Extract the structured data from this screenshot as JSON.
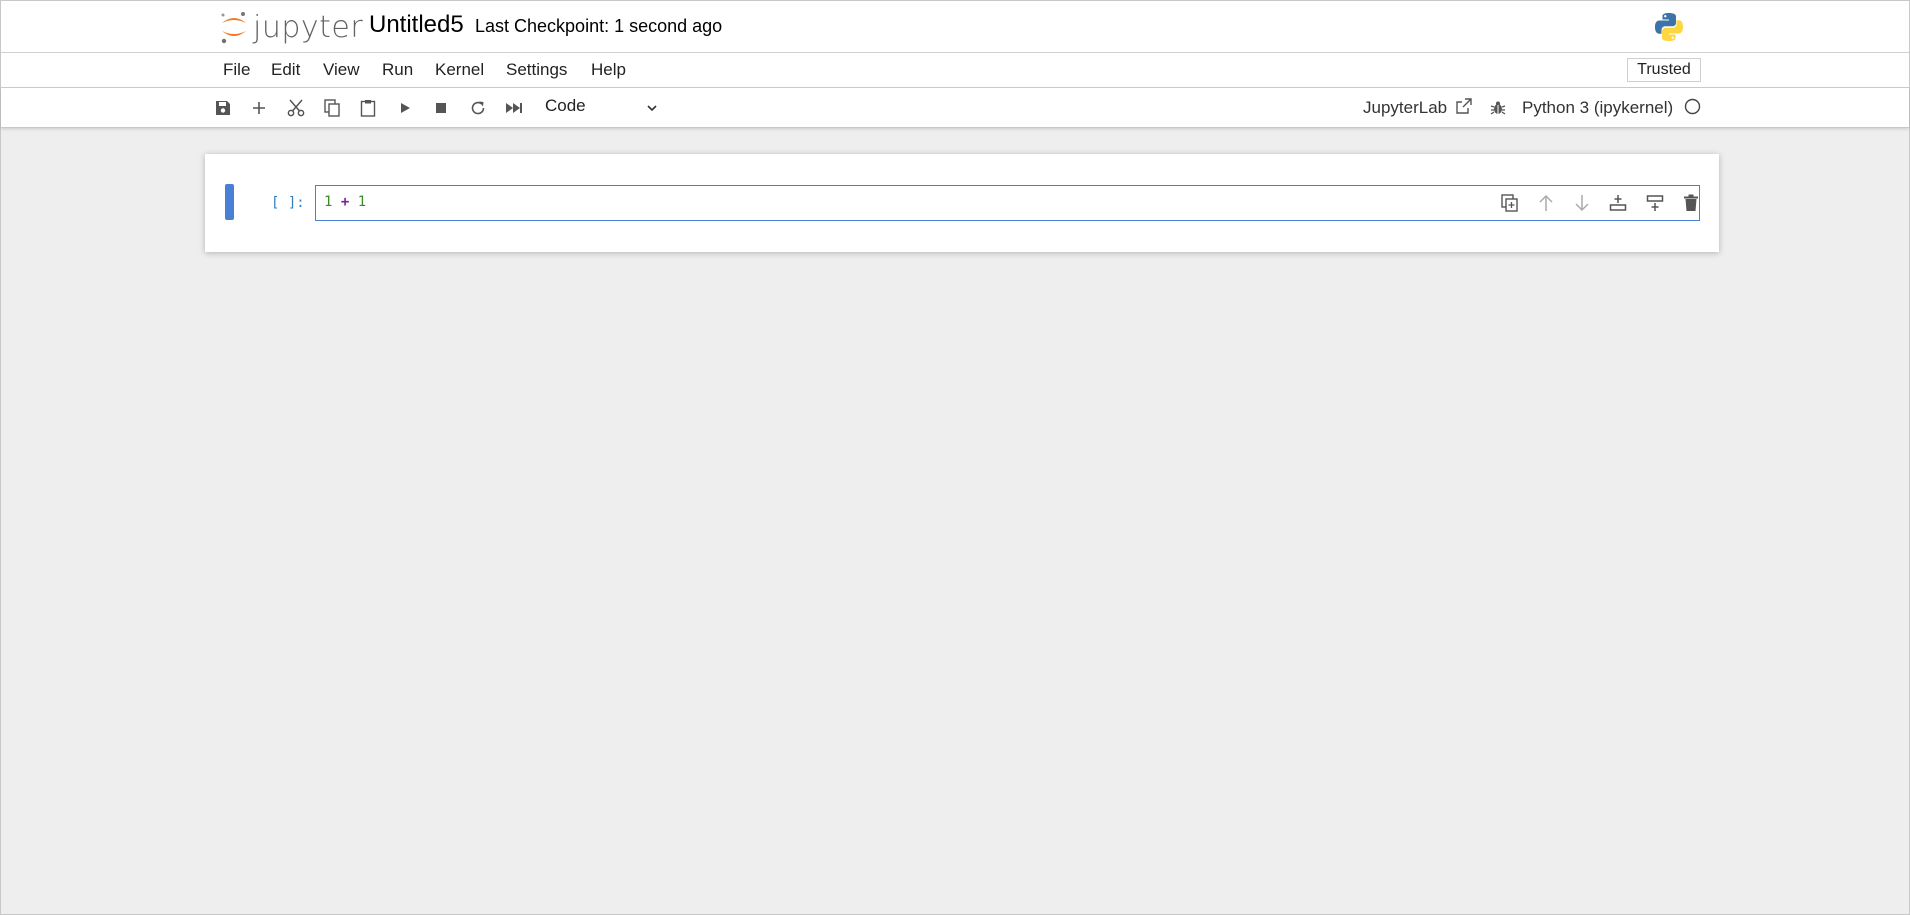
{
  "header": {
    "logo_text": "jupyter",
    "notebook_title": "Untitled5",
    "checkpoint": "Last Checkpoint: 1 second ago",
    "kernel_logo_icon": "python-logo-icon"
  },
  "menu": {
    "items": [
      "File",
      "Edit",
      "View",
      "Run",
      "Kernel",
      "Settings",
      "Help"
    ],
    "trusted_label": "Trusted"
  },
  "toolbar": {
    "buttons": [
      "save-icon",
      "add-cell-icon",
      "cut-icon",
      "copy-icon",
      "paste-icon",
      "run-icon",
      "stop-icon",
      "restart-icon",
      "run-all-icon"
    ],
    "cell_type": "Code",
    "jupyterlab_label": "JupyterLab",
    "kernel_name": "Python 3 (ipykernel)",
    "kernel_status": "idle"
  },
  "cells": [
    {
      "prompt": "[ ]:",
      "code": {
        "left": "1",
        "op": "+",
        "right": "1"
      }
    }
  ],
  "cell_toolbar": [
    "duplicate-icon",
    "move-up-icon",
    "move-down-icon",
    "insert-above-icon",
    "insert-below-icon",
    "delete-icon"
  ],
  "colors": {
    "accent": "#4a7fd6",
    "jupyter_orange": "#f37726",
    "background": "#eeeeee"
  }
}
